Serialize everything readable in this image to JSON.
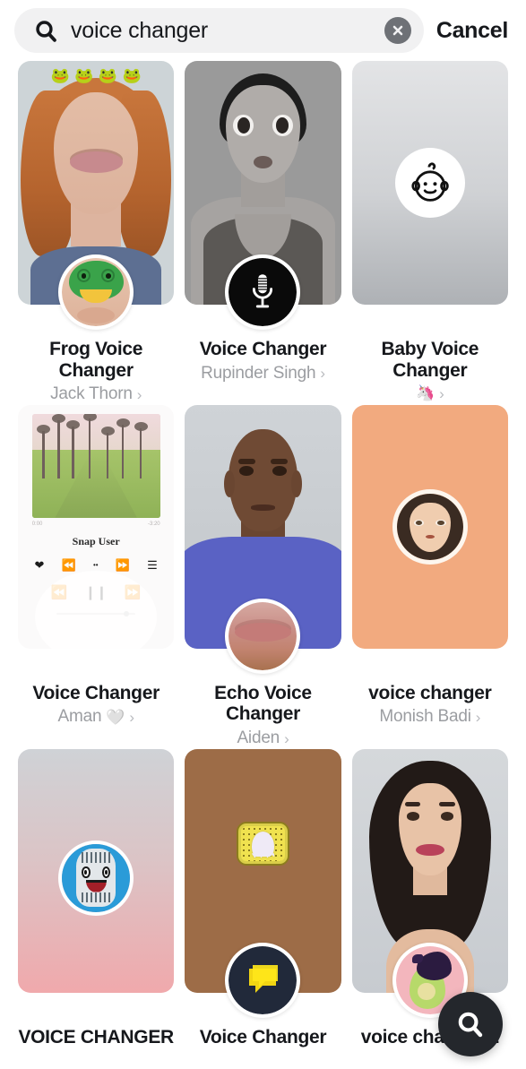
{
  "search": {
    "query": "voice changer",
    "placeholder": "Search",
    "icon": "search-icon",
    "clear_icon": "close-icon",
    "cancel_label": "Cancel"
  },
  "fab": {
    "icon": "search-icon",
    "label": "Search"
  },
  "results": [
    {
      "title": "Frog Voice Changer",
      "author": "Jack Thorn",
      "author_emoji": "",
      "chevron": "›",
      "badge_icon": "frog-face-lens-icon",
      "thumb": "frog-filter-woman-preview"
    },
    {
      "title": "Voice Changer",
      "author": "Rupinder Singh",
      "author_emoji": "",
      "chevron": "›",
      "badge_icon": "microphone-icon",
      "thumb": "big-eyes-bw-woman-preview"
    },
    {
      "title": "Baby Voice Changer",
      "author": "",
      "author_emoji": "🦄",
      "chevron": "›",
      "badge_icon": "baby-face-icon",
      "thumb": "gray-gradient-preview"
    },
    {
      "title": "Voice Changer",
      "author": "Aman",
      "author_emoji": "🤍",
      "chevron": "›",
      "badge_icon": "",
      "thumb": "music-player-preview",
      "player": {
        "user": "Snap User",
        "time_start": "0:00",
        "time_end": "-3:20",
        "icons": [
          "heart-icon",
          "rewind-icon",
          "shuffle-icon",
          "fast-forward-icon",
          "playlist-icon",
          "previous-track-icon",
          "pause-icon",
          "next-track-icon"
        ]
      }
    },
    {
      "title": "Echo Voice Changer",
      "author": "Aiden",
      "author_emoji": "",
      "chevron": "›",
      "badge_icon": "big-lips-icon",
      "thumb": "bald-man-blue-shirt-preview"
    },
    {
      "title": "voice changer",
      "author": "Monish Badi",
      "author_emoji": "",
      "chevron": "›",
      "badge_icon": "girl-face-icon",
      "thumb": "peach-background-preview"
    },
    {
      "title": "VOICE CHANGER",
      "author": "",
      "author_emoji": "",
      "chevron": "",
      "badge_icon": "robot-microphone-icon",
      "thumb": "pink-gradient-preview"
    },
    {
      "title": "Voice Changer",
      "author": "",
      "author_emoji": "",
      "chevron": "",
      "badge_icon": "yellow-speech-bubble-icon",
      "thumb": "wood-snapcode-preview"
    },
    {
      "title": "voice changer 2",
      "author": "",
      "author_emoji": "",
      "chevron": "",
      "badge_icon": "avocado-girl-icon",
      "thumb": "long-hair-woman-preview"
    }
  ],
  "colors": {
    "page_bg": "#ffffff",
    "search_field_bg": "#f1f1f2",
    "text_primary": "#16181c",
    "text_secondary": "#9b9da1",
    "clear_button_bg": "#6e7176",
    "fab_bg": "#24272c",
    "peach_card": "#f2aa7f"
  }
}
